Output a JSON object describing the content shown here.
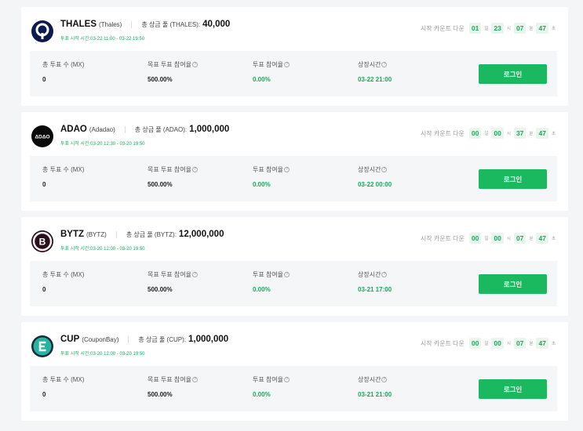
{
  "colors": {
    "accent": "#1ab85f",
    "green_text": "#1aaa5e",
    "badge_bg": "#e8f6ee"
  },
  "common": {
    "countdown_label": "시작 카운트 다운",
    "unit_day": "일",
    "unit_hour": "시",
    "unit_minute": "분",
    "unit_second": "초",
    "col_votes": "총 투표 수 (MX)",
    "col_target": "목표 투표 참여율",
    "col_participation": "투표 참여율",
    "col_listing": "상장시간",
    "login": "로그인"
  },
  "projects": [
    {
      "symbol": "THALES",
      "name": "(Thales)",
      "pool_label": "총 상금 풀 (THALES):",
      "pool_amount": "40,000",
      "vote_time": "투표 시작 시간:03-22 11:00 - 03-22 19:50",
      "countdown": {
        "d": "01",
        "h": "23",
        "m": "07",
        "s": "47"
      },
      "votes": "0",
      "target": "500.00%",
      "participation": "0.00%",
      "listing": "03-22 21:00",
      "logo_icon": "thales-logo-icon"
    },
    {
      "symbol": "ADAO",
      "name": "(Adadao)",
      "pool_label": "총 상금 풀 (ADAO):",
      "pool_amount": "1,000,000",
      "vote_time": "투표 시작 시간:03-20 12:30 - 03-20 19:50",
      "countdown": {
        "d": "00",
        "h": "00",
        "m": "37",
        "s": "47"
      },
      "votes": "0",
      "target": "500.00%",
      "participation": "0.00%",
      "listing": "03-22 00:00",
      "logo_icon": "adao-logo-icon"
    },
    {
      "symbol": "BYTZ",
      "name": "(BYTZ)",
      "pool_label": "총 상금 풀 (BYTZ):",
      "pool_amount": "12,000,000",
      "vote_time": "투표 시작 시간:03-20 12:00 - 03-20 19:50",
      "countdown": {
        "d": "00",
        "h": "00",
        "m": "07",
        "s": "47"
      },
      "votes": "0",
      "target": "500.00%",
      "participation": "0.00%",
      "listing": "03-21 17:00",
      "logo_icon": "bytz-logo-icon"
    },
    {
      "symbol": "CUP",
      "name": "(CouponBay)",
      "pool_label": "총 상금 풀 (CUP):",
      "pool_amount": "1,000,000",
      "vote_time": "투표 시작 시간:03-20 12:00 - 03-20 19:50",
      "countdown": {
        "d": "00",
        "h": "00",
        "m": "07",
        "s": "47"
      },
      "votes": "0",
      "target": "500.00%",
      "participation": "0.00%",
      "listing": "03-21 21:00",
      "logo_icon": "couponbay-logo-icon"
    }
  ]
}
